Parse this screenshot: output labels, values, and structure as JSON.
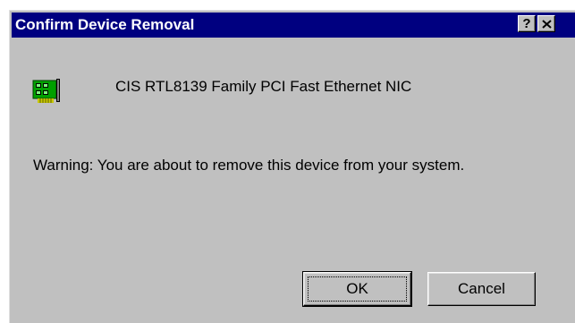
{
  "window": {
    "title": "Confirm Device Removal",
    "help_label": "?",
    "close_icon": "close-icon"
  },
  "device": {
    "icon": "network-card-icon",
    "name": "CIS RTL8139 Family PCI Fast Ethernet NIC"
  },
  "message": {
    "warning": "Warning: You are about to remove this device from your system."
  },
  "buttons": {
    "ok_label": "OK",
    "cancel_label": "Cancel"
  },
  "colors": {
    "titlebar": "#000080",
    "face": "#c0c0c0",
    "icon_green": "#00a000",
    "icon_gold": "#c8c800"
  }
}
